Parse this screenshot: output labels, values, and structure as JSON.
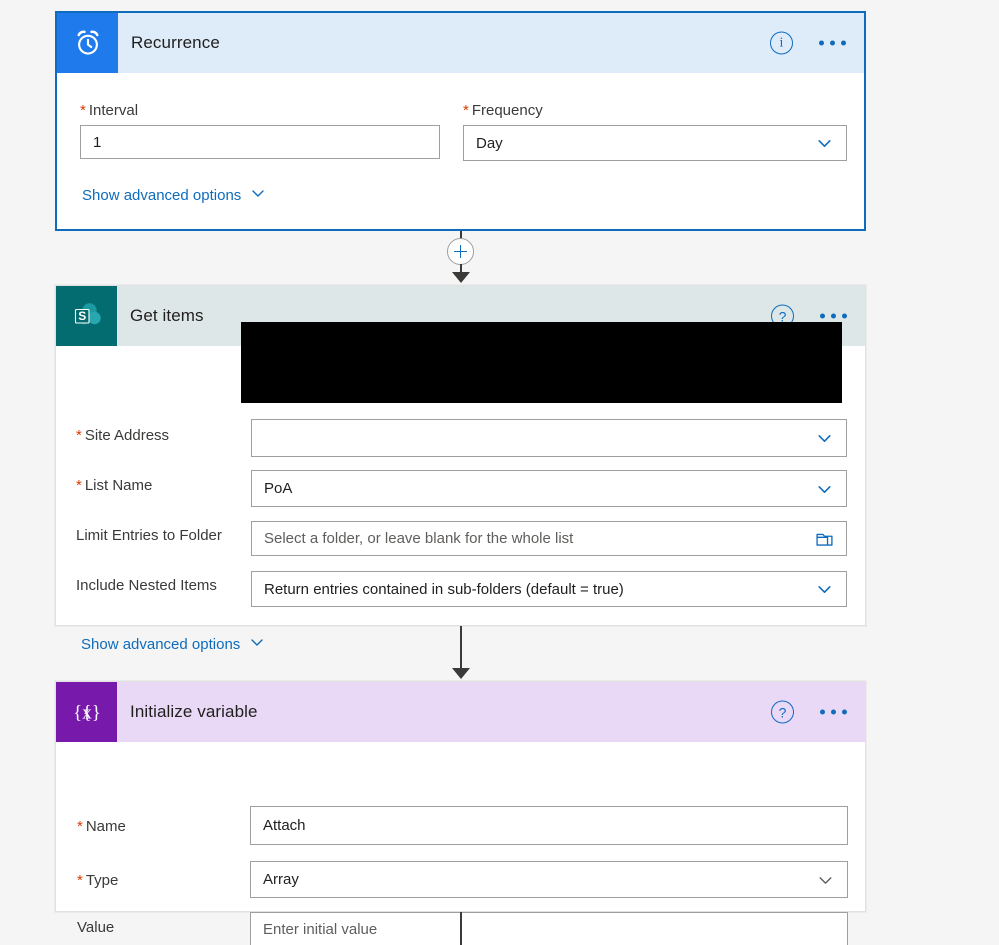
{
  "page": {
    "background": "#f5f5f5",
    "app": "Power Automate flow designer"
  },
  "colors": {
    "recurrence_icon_bg": "#1f7aec",
    "recurrence_header_bg": "#deebf9",
    "recurrence_border": "#0f6cbd",
    "sharepoint_icon_bg": "#036c70",
    "getitems_header_bg": "#dde7e7",
    "variable_icon_bg": "#7719aa",
    "variable_header_bg": "#e9d9f7",
    "accent_blue": "#0f6cbd",
    "required_red": "#d83b01"
  },
  "cards": [
    {
      "id": "recurrence",
      "title": "Recurrence",
      "icon": "alarm-clock-icon",
      "info_icon": "info-icon",
      "menu_icon": "more-options-icon",
      "advanced_link": "Show advanced options",
      "fields": [
        {
          "name": "interval",
          "label": "Interval",
          "required": true,
          "control": "text",
          "value": "1",
          "placeholder": ""
        },
        {
          "name": "frequency",
          "label": "Frequency",
          "required": true,
          "control": "dropdown",
          "value": "Day",
          "placeholder": ""
        }
      ]
    },
    {
      "id": "get-items",
      "title": "Get items",
      "icon": "sharepoint-icon",
      "info_icon": "help-icon",
      "menu_icon": "more-options-icon",
      "advanced_link": "Show advanced options",
      "fields": [
        {
          "name": "site-address",
          "label": "Site Address",
          "required": true,
          "control": "dropdown",
          "value": "",
          "placeholder": "",
          "redacted": true
        },
        {
          "name": "list-name",
          "label": "List Name",
          "required": true,
          "control": "dropdown",
          "value": "PoA",
          "placeholder": ""
        },
        {
          "name": "limit-entries-to-folder",
          "label": "Limit Entries to Folder",
          "required": false,
          "control": "folder-picker",
          "value": "",
          "placeholder": "Select a folder, or leave blank for the whole list"
        },
        {
          "name": "include-nested-items",
          "label": "Include Nested Items",
          "required": false,
          "control": "dropdown",
          "value": "Return entries contained in sub-folders (default = true)",
          "placeholder": ""
        }
      ]
    },
    {
      "id": "initialize-variable",
      "title": "Initialize variable",
      "icon": "variable-braces-icon",
      "info_icon": "help-icon",
      "menu_icon": "more-options-icon",
      "advanced_link": "",
      "fields": [
        {
          "name": "variable-name",
          "label": "Name",
          "required": true,
          "control": "text",
          "value": "Attach",
          "placeholder": ""
        },
        {
          "name": "variable-type",
          "label": "Type",
          "required": true,
          "control": "dropdown",
          "value": "Array",
          "placeholder": ""
        },
        {
          "name": "variable-value",
          "label": "Value",
          "required": false,
          "control": "text",
          "value": "",
          "placeholder": "Enter initial value"
        }
      ]
    }
  ],
  "connectors": [
    {
      "name": "recurrence-to-get-items",
      "has_add_button": true,
      "add_label": "+"
    },
    {
      "name": "get-items-to-initialize-variable",
      "has_add_button": false,
      "add_label": ""
    },
    {
      "name": "initialize-variable-to-next",
      "has_add_button": false,
      "add_label": ""
    }
  ]
}
